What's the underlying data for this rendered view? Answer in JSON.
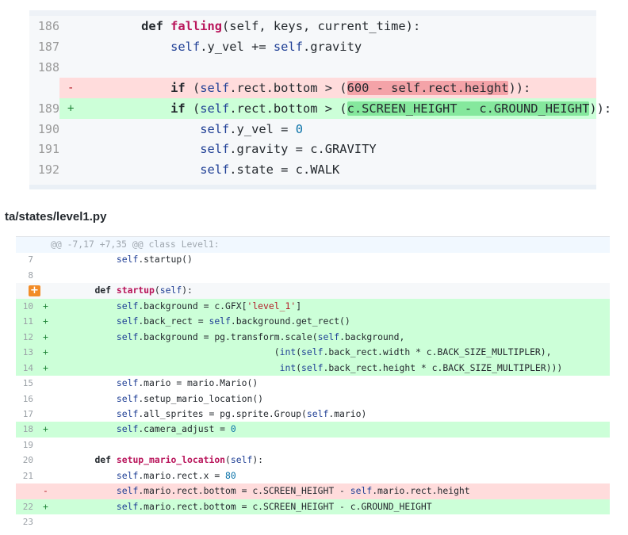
{
  "zoom": {
    "rows": [
      {
        "num": "186",
        "mark": "",
        "type": "ctx",
        "indent": "    ",
        "parts": [
          [
            "kw",
            "def "
          ],
          [
            "fn",
            "falling"
          ],
          [
            "",
            "(self, keys, current_time):"
          ]
        ]
      },
      {
        "num": "187",
        "mark": "",
        "type": "ctx",
        "indent": "        ",
        "parts": [
          [
            "sf",
            "self"
          ],
          [
            "",
            ".y_vel += "
          ],
          [
            "sf",
            "self"
          ],
          [
            "",
            ".gravity"
          ]
        ]
      },
      {
        "num": "188",
        "mark": "",
        "type": "ctx",
        "indent": "",
        "parts": []
      },
      {
        "num": "",
        "mark": "-",
        "type": "del",
        "indent": "        ",
        "parts": [
          [
            "kw",
            "if "
          ],
          [
            "",
            "("
          ],
          [
            "sf",
            "self"
          ],
          [
            "",
            ".rect.bottom > ("
          ],
          [
            "hl-del",
            "600 - self.rect.height"
          ],
          [
            "",
            "))"
          ],
          [
            "",
            ":"
          ]
        ]
      },
      {
        "num": "189",
        "mark": "+",
        "type": "add",
        "indent": "        ",
        "parts": [
          [
            "kw",
            "if "
          ],
          [
            "",
            "("
          ],
          [
            "sf",
            "self"
          ],
          [
            "",
            ".rect.bottom > ("
          ],
          [
            "hl-add",
            "c.SCREEN_HEIGHT - c.GROUND_HEIGHT"
          ],
          [
            "",
            "))"
          ],
          [
            "",
            ":"
          ]
        ]
      },
      {
        "num": "190",
        "mark": "",
        "type": "ctx",
        "indent": "            ",
        "parts": [
          [
            "sf",
            "self"
          ],
          [
            "",
            ".y_vel = "
          ],
          [
            "nm",
            "0"
          ]
        ]
      },
      {
        "num": "191",
        "mark": "",
        "type": "ctx",
        "indent": "            ",
        "parts": [
          [
            "sf",
            "self"
          ],
          [
            "",
            ".gravity = c.GRAVITY"
          ]
        ]
      },
      {
        "num": "192",
        "mark": "",
        "type": "ctx",
        "indent": "            ",
        "parts": [
          [
            "sf",
            "self"
          ],
          [
            "",
            ".state = c.WALK"
          ]
        ]
      }
    ]
  },
  "file": {
    "path": "ta/states/level1.py"
  },
  "diff": {
    "expand_label": "+",
    "rows": [
      {
        "num": "",
        "mark": "",
        "type": "hunk",
        "parts": [
          [
            "",
            "@@ -7,17 +7,35 @@ class Level1:"
          ]
        ]
      },
      {
        "num": "7",
        "mark": "",
        "type": "ctx",
        "parts": [
          [
            "",
            "        "
          ],
          [
            "sf",
            "self"
          ],
          [
            "",
            ".startup()"
          ]
        ]
      },
      {
        "num": "8",
        "mark": "",
        "type": "ctx",
        "parts": []
      },
      {
        "num": "",
        "mark": "",
        "type": "ctx-gray",
        "expand": true,
        "parts": [
          [
            "",
            "    "
          ],
          [
            "kw",
            "def "
          ],
          [
            "fn",
            "startup"
          ],
          [
            "",
            "("
          ],
          [
            "sf",
            "self"
          ],
          [
            "",
            "):"
          ]
        ]
      },
      {
        "num": "10",
        "mark": "+",
        "type": "add",
        "parts": [
          [
            "",
            "        "
          ],
          [
            "sf",
            "self"
          ],
          [
            "",
            ".background = c.GFX["
          ],
          [
            "st",
            "'level_1'"
          ],
          [
            "",
            "]"
          ]
        ]
      },
      {
        "num": "11",
        "mark": "+",
        "type": "add",
        "parts": [
          [
            "",
            "        "
          ],
          [
            "sf",
            "self"
          ],
          [
            "",
            ".back_rect = "
          ],
          [
            "sf",
            "self"
          ],
          [
            "",
            ".background.get_rect()"
          ]
        ]
      },
      {
        "num": "12",
        "mark": "+",
        "type": "add",
        "parts": [
          [
            "",
            "        "
          ],
          [
            "sf",
            "self"
          ],
          [
            "",
            ".background = pg.transform.scale("
          ],
          [
            "sf",
            "self"
          ],
          [
            "",
            ".background,"
          ]
        ]
      },
      {
        "num": "13",
        "mark": "+",
        "type": "add",
        "parts": [
          [
            "",
            "                                     ("
          ],
          [
            "sf",
            "int"
          ],
          [
            "",
            "("
          ],
          [
            "sf",
            "self"
          ],
          [
            "",
            ".back_rect.width * c.BACK_SIZE_MULTIPLER),"
          ]
        ]
      },
      {
        "num": "14",
        "mark": "+",
        "type": "add",
        "parts": [
          [
            "",
            "                                      "
          ],
          [
            "sf",
            "int"
          ],
          [
            "",
            "("
          ],
          [
            "sf",
            "self"
          ],
          [
            "",
            ".back_rect.height * c.BACK_SIZE_MULTIPLER)))"
          ]
        ]
      },
      {
        "num": "15",
        "mark": "",
        "type": "ctx",
        "parts": [
          [
            "",
            "        "
          ],
          [
            "sf",
            "self"
          ],
          [
            "",
            ".mario = mario.Mario()"
          ]
        ]
      },
      {
        "num": "16",
        "mark": "",
        "type": "ctx",
        "parts": [
          [
            "",
            "        "
          ],
          [
            "sf",
            "self"
          ],
          [
            "",
            ".setup_mario_location()"
          ]
        ]
      },
      {
        "num": "17",
        "mark": "",
        "type": "ctx",
        "parts": [
          [
            "",
            "        "
          ],
          [
            "sf",
            "self"
          ],
          [
            "",
            ".all_sprites = pg.sprite.Group("
          ],
          [
            "sf",
            "self"
          ],
          [
            "",
            ".mario)"
          ]
        ]
      },
      {
        "num": "18",
        "mark": "+",
        "type": "add",
        "parts": [
          [
            "",
            "        "
          ],
          [
            "sf",
            "self"
          ],
          [
            "",
            ".camera_adjust = "
          ],
          [
            "nm",
            "0"
          ]
        ]
      },
      {
        "num": "19",
        "mark": "",
        "type": "ctx",
        "parts": []
      },
      {
        "num": "20",
        "mark": "",
        "type": "ctx",
        "parts": [
          [
            "",
            "    "
          ],
          [
            "kw",
            "def "
          ],
          [
            "fn",
            "setup_mario_location"
          ],
          [
            "",
            "("
          ],
          [
            "sf",
            "self"
          ],
          [
            "",
            "):"
          ]
        ]
      },
      {
        "num": "21",
        "mark": "",
        "type": "ctx",
        "parts": [
          [
            "",
            "        "
          ],
          [
            "sf",
            "self"
          ],
          [
            "",
            ".mario.rect.x = "
          ],
          [
            "nm",
            "80"
          ]
        ]
      },
      {
        "num": "",
        "mark": "-",
        "type": "del",
        "parts": [
          [
            "",
            "        "
          ],
          [
            "sf",
            "self"
          ],
          [
            "",
            ".mario.rect.bottom = c.SCREEN_HEIGHT - "
          ],
          [
            "sf",
            "self"
          ],
          [
            "",
            ".mario.rect.height"
          ]
        ]
      },
      {
        "num": "22",
        "mark": "+",
        "type": "add",
        "parts": [
          [
            "",
            "        "
          ],
          [
            "sf",
            "self"
          ],
          [
            "",
            ".mario.rect.bottom = c.SCREEN_HEIGHT - c.GROUND_HEIGHT"
          ]
        ]
      },
      {
        "num": "23",
        "mark": "",
        "type": "ctx",
        "parts": []
      }
    ]
  }
}
